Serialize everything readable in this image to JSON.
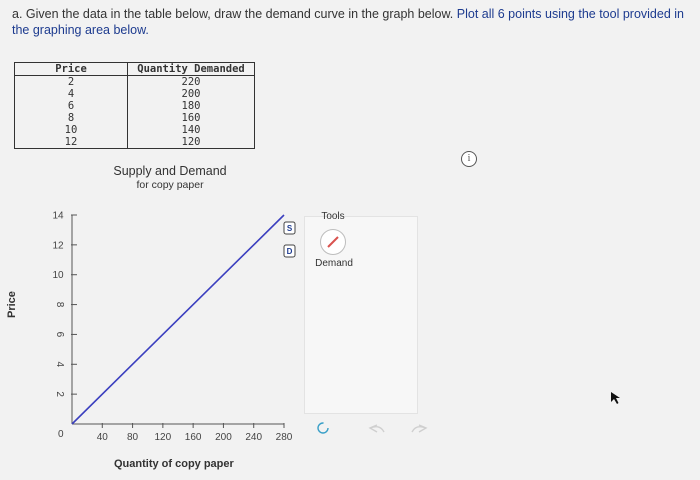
{
  "question": {
    "prefix": "a. Given the data in the table below, draw the demand curve in the graph below.",
    "instruction": "Plot all 6 points using the tool provided in the graphing area below."
  },
  "table": {
    "headers": [
      "Price",
      "Quantity Demanded"
    ],
    "rows": [
      [
        "2",
        "220"
      ],
      [
        "4",
        "200"
      ],
      [
        "6",
        "180"
      ],
      [
        "8",
        "160"
      ],
      [
        "10",
        "140"
      ],
      [
        "12",
        "120"
      ]
    ]
  },
  "info_icon": "info-icon",
  "chart_data": {
    "type": "line",
    "title": "Supply and Demand",
    "subtitle": "for copy paper",
    "xlabel": "Quantity of copy paper",
    "ylabel": "Price",
    "xlim": [
      0,
      280
    ],
    "ylim": [
      0,
      14
    ],
    "x_ticks": [
      "40",
      "80",
      "120",
      "160",
      "200",
      "240",
      "280"
    ],
    "y_ticks": [
      "2",
      "4",
      "6",
      "8",
      "10",
      "12",
      "14"
    ],
    "origin_label": "0",
    "series": [
      {
        "name": "S",
        "x": [
          0,
          280
        ],
        "y": [
          0,
          14
        ],
        "color": "#3b3fbf"
      }
    ],
    "markers": [
      "S",
      "D"
    ],
    "grid": false
  },
  "tools": {
    "title": "Tools",
    "demand_label": "Demand",
    "demand_color": "#d9534f",
    "reset_icon": "reset-icon",
    "undo_icon": "undo-icon",
    "redo_icon": "redo-icon"
  },
  "cursor_icon": "mouse-cursor-icon"
}
